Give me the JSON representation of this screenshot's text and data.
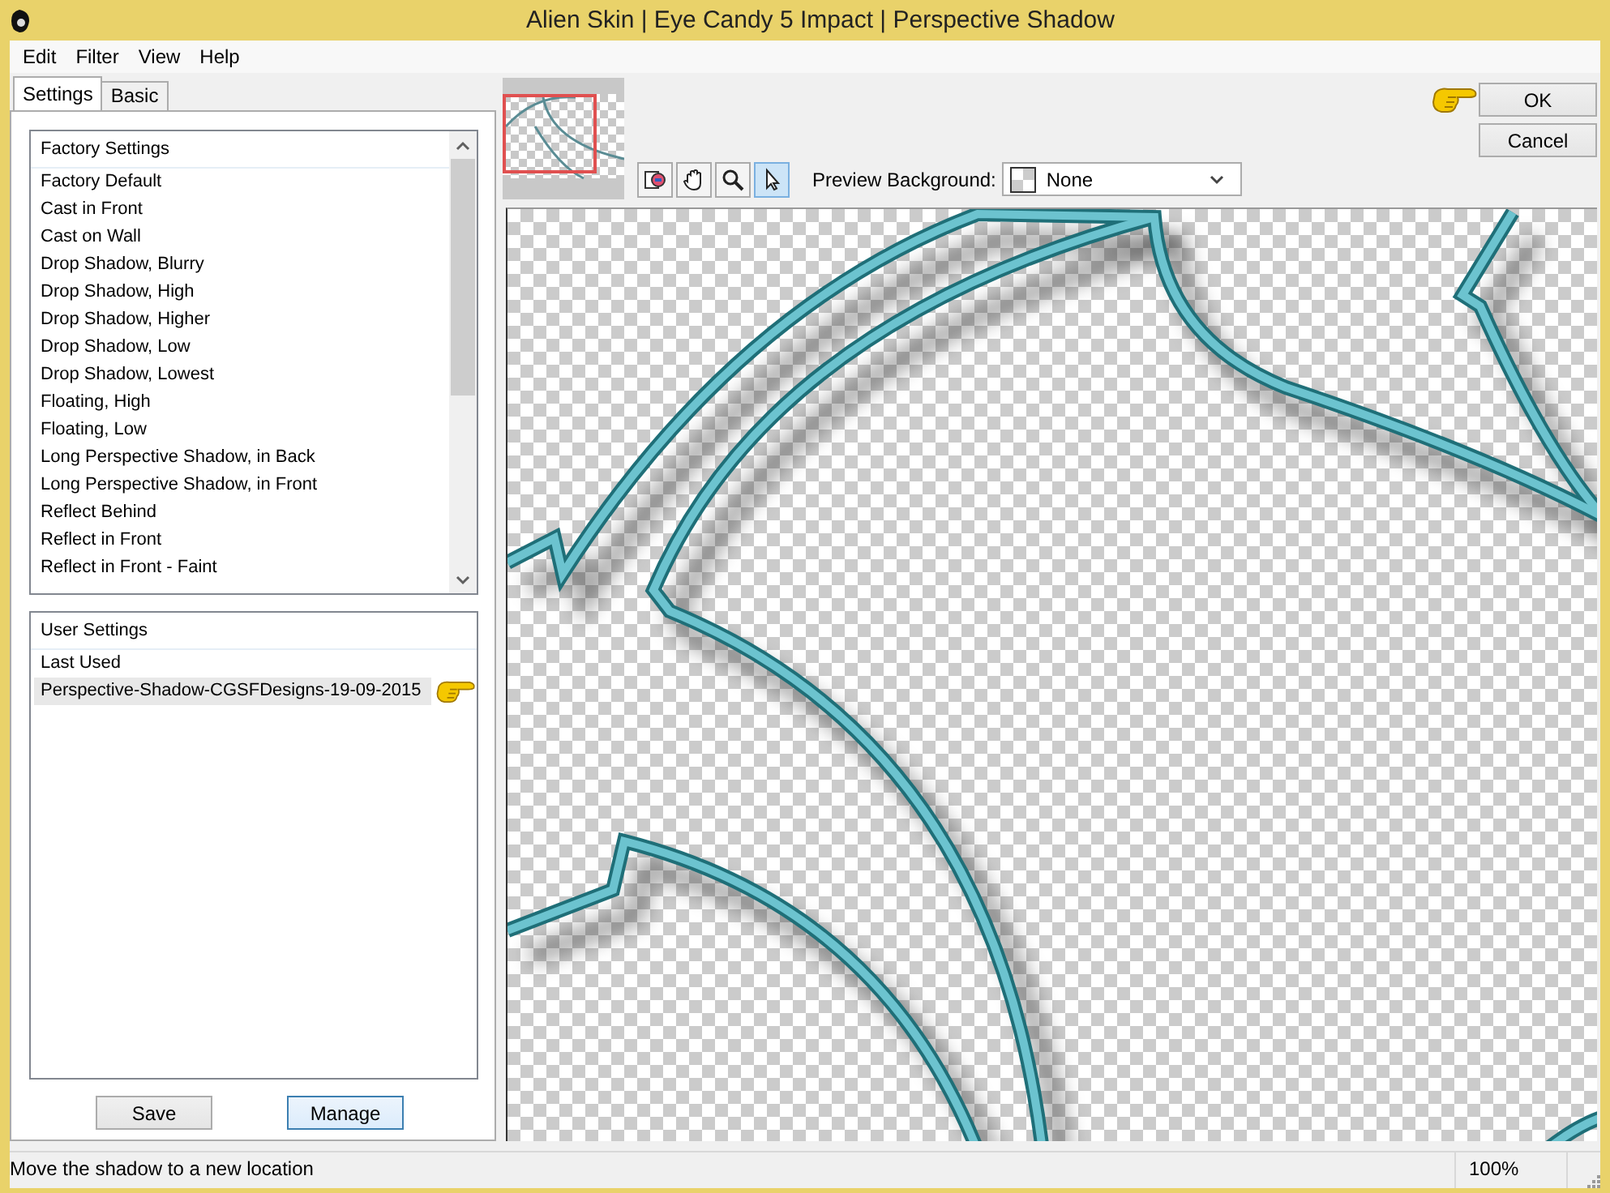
{
  "window": {
    "title": "Alien Skin | Eye Candy 5 Impact | Perspective Shadow"
  },
  "menu": [
    "Edit",
    "Filter",
    "View",
    "Help"
  ],
  "tabs": [
    {
      "label": "Settings",
      "selected": true
    },
    {
      "label": "Basic",
      "selected": false
    }
  ],
  "factory_settings": {
    "header": "Factory Settings",
    "items": [
      "Factory Default",
      "Cast in Front",
      "Cast on Wall",
      "Drop Shadow, Blurry",
      "Drop Shadow, High",
      "Drop Shadow, Higher",
      "Drop Shadow, Low",
      "Drop Shadow, Lowest",
      "Floating, High",
      "Floating, Low",
      "Long Perspective Shadow, in Back",
      "Long Perspective Shadow, in Front",
      "Reflect Behind",
      "Reflect in Front",
      "Reflect in Front - Faint"
    ]
  },
  "user_settings": {
    "header": "User Settings",
    "items": [
      {
        "label": "Last Used",
        "selected": false
      },
      {
        "label": "Perspective-Shadow-CGSFDesigns-19-09-2015",
        "selected": true
      }
    ]
  },
  "settings_buttons": [
    {
      "label": "Save",
      "focused": false
    },
    {
      "label": "Manage",
      "focused": true
    }
  ],
  "tools": [
    {
      "kind": "compare",
      "selected": false
    },
    {
      "kind": "hand",
      "selected": false
    },
    {
      "kind": "zoom",
      "selected": false
    },
    {
      "kind": "pointer",
      "selected": true
    }
  ],
  "preview_background": {
    "label": "Preview Background:",
    "value": "None"
  },
  "dialog_buttons": [
    "OK",
    "Cancel"
  ],
  "status_bar": {
    "message": "Move the shadow to a new location",
    "zoom": "100%"
  }
}
